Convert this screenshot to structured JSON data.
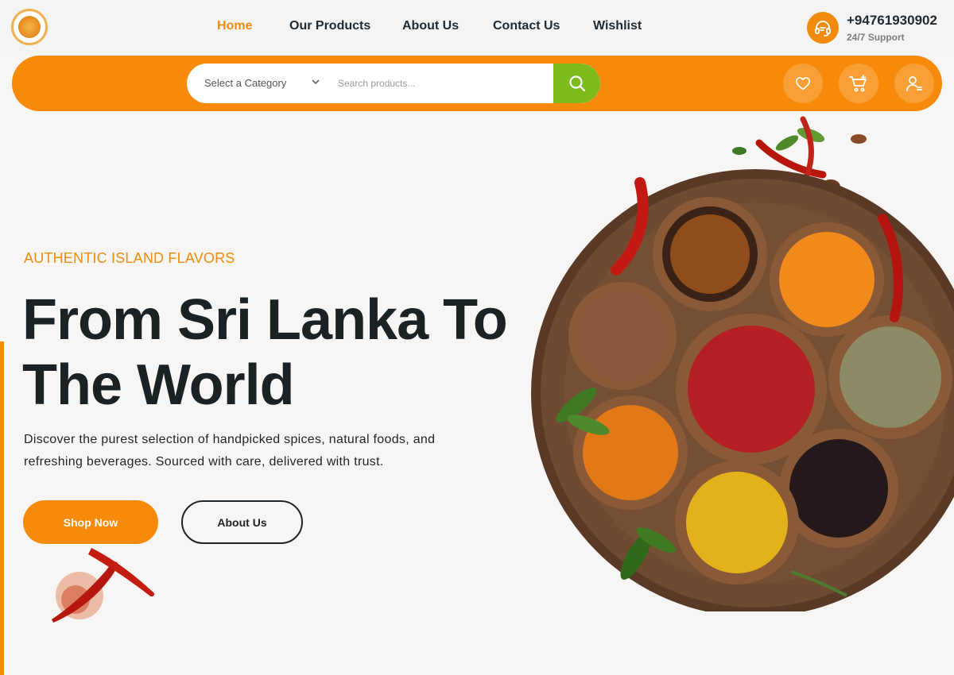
{
  "nav": {
    "items": [
      {
        "label": "Home",
        "active": true
      },
      {
        "label": "Our Products",
        "active": false
      },
      {
        "label": "About Us",
        "active": false
      },
      {
        "label": "Contact Us",
        "active": false
      },
      {
        "label": "Wishlist",
        "active": false
      }
    ]
  },
  "support": {
    "phone": "+94761930902",
    "label": "24/7 Support",
    "icon": "headset-icon"
  },
  "search": {
    "category": "Select a Category",
    "placeholder": "Search products..."
  },
  "actions": {
    "icons": [
      "heart-icon",
      "cart-icon",
      "user-icon"
    ]
  },
  "hero": {
    "eyebrow": "AUTHENTIC ISLAND FLAVORS",
    "headline_line1": "From Sri Lanka To",
    "headline_line2": "The World",
    "description_line1": "Discover the purest selection of handpicked spices, natural foods, and",
    "description_line2": "refreshing beverages. Sourced with care, delivered with trust.",
    "primary_button": "Shop Now",
    "secondary_button": "About Us"
  },
  "colors": {
    "accent": "#f78a0a",
    "search_button": "#7dbb1c",
    "heading": "#1b2226"
  }
}
